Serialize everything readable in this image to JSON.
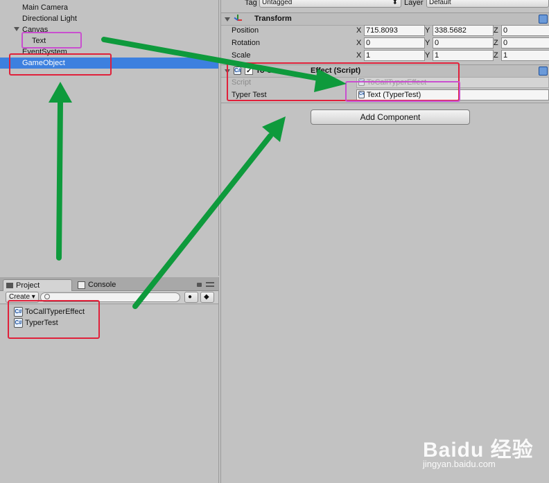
{
  "hierarchy": {
    "items": [
      {
        "label": "Main Camera"
      },
      {
        "label": "Directional Light"
      },
      {
        "label": "Canvas"
      },
      {
        "label": "Text"
      },
      {
        "label": "EventSystem"
      },
      {
        "label": "GameObject"
      }
    ]
  },
  "project": {
    "tabs": [
      {
        "label": "Project"
      },
      {
        "label": "Console"
      }
    ],
    "create_label": "Create",
    "files": [
      {
        "label": "ToCallTyperEffect",
        "icon": "cs-script-icon"
      },
      {
        "label": "TyperTest",
        "icon": "cs-script-icon"
      }
    ]
  },
  "inspector": {
    "tag_label": "Tag",
    "tag_value": "Untagged",
    "layer_label": "Layer",
    "layer_value": "Default",
    "transform": {
      "title": "Transform",
      "rows": [
        {
          "label": "Position",
          "x": "715.8093",
          "y": "338.5682",
          "z": "0"
        },
        {
          "label": "Rotation",
          "x": "0",
          "y": "0",
          "z": "0"
        },
        {
          "label": "Scale",
          "x": "1",
          "y": "1",
          "z": "1"
        }
      ],
      "axis": {
        "x": "X",
        "y": "Y",
        "z": "Z"
      }
    },
    "script_component": {
      "title_left": "To Ca",
      "title_right": "Effect (Script)",
      "script_label": "Script",
      "script_value": "ToCallTyperEffect",
      "typer_label": "Typer Test",
      "typer_value": "Text (TyperTest)"
    },
    "add_component_label": "Add Component"
  },
  "watermark": {
    "brand": "Baidu 经验",
    "url": "jingyan.baidu.com"
  },
  "colors": {
    "selection": "#3d80df",
    "annotation_red": "#e0203a",
    "annotation_pink": "#c94fcf",
    "arrow_green": "#0e9a3c"
  }
}
